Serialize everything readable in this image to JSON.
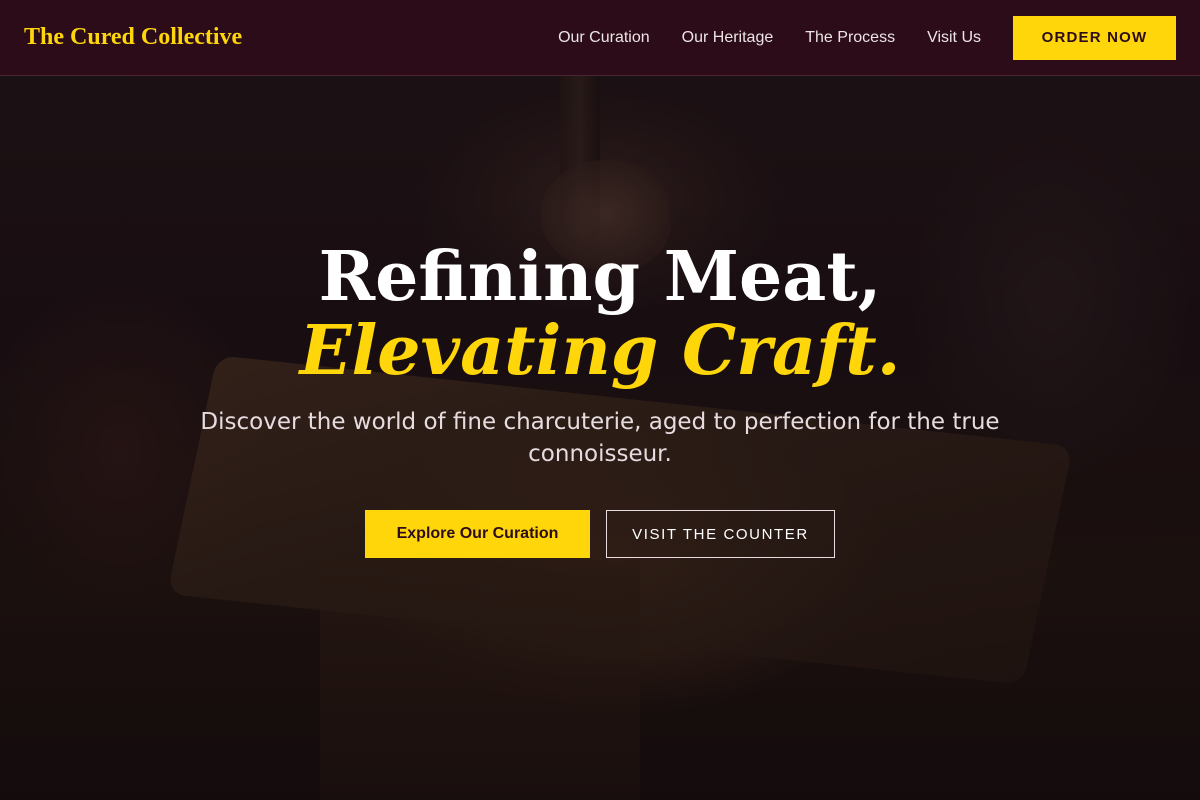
{
  "brand": {
    "name": "The Cured Collective",
    "color": "#ffd60a"
  },
  "nav": {
    "links": [
      "Our Curation",
      "Our Heritage",
      "The Process",
      "Visit Us"
    ],
    "cta_label": "ORDER NOW"
  },
  "hero": {
    "headline_line1": "Refining Meat,",
    "headline_line2": "Elevating Craft.",
    "subtitle": "Discover the world of fine charcuterie, aged to perfection for the true connoisseur.",
    "primary_button": "Explore Our Curation",
    "secondary_button": "VISIT THE COUNTER"
  },
  "colors": {
    "nav_background": "#2b0c18",
    "accent": "#ffd60a",
    "text_light": "#ffffff"
  }
}
